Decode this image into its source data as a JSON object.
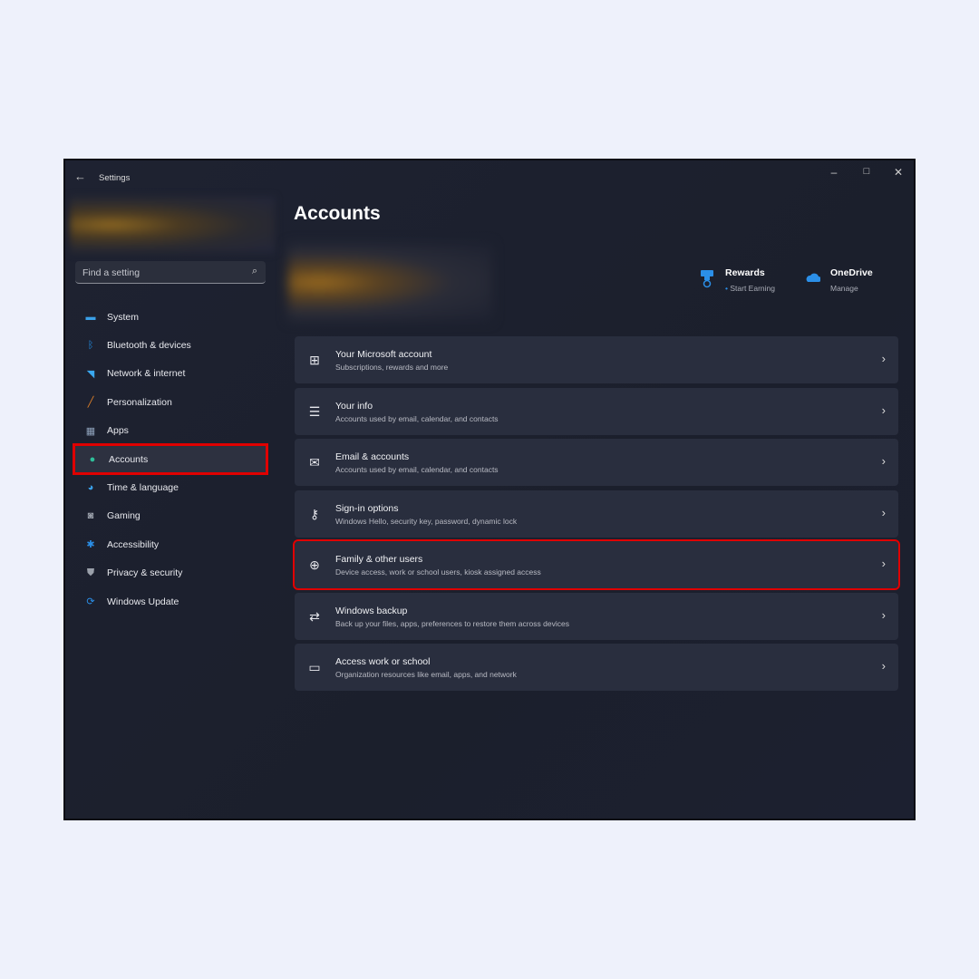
{
  "window": {
    "title": "Settings",
    "minimize": "–",
    "maximize": "□",
    "close": "✕",
    "back": "←"
  },
  "search": {
    "placeholder": "Find a setting"
  },
  "sidebar": {
    "items": [
      {
        "label": "System",
        "icon": "monitor-icon",
        "color": "#3aa0e8"
      },
      {
        "label": "Bluetooth & devices",
        "icon": "bluetooth-icon",
        "color": "#1f8fe6"
      },
      {
        "label": "Network & internet",
        "icon": "wifi-icon",
        "color": "#3aa8f0"
      },
      {
        "label": "Personalization",
        "icon": "brush-icon",
        "color": "#e0802a"
      },
      {
        "label": "Apps",
        "icon": "apps-icon",
        "color": "#8fa2bb"
      },
      {
        "label": "Accounts",
        "icon": "person-icon",
        "color": "#2fbf9a",
        "selected": true
      },
      {
        "label": "Time & language",
        "icon": "globe-clock-icon",
        "color": "#3aa0e8"
      },
      {
        "label": "Gaming",
        "icon": "gamepad-icon",
        "color": "#9aa0aa"
      },
      {
        "label": "Accessibility",
        "icon": "accessibility-icon",
        "color": "#2b8fe8"
      },
      {
        "label": "Privacy & security",
        "icon": "shield-icon",
        "color": "#9aa0aa"
      },
      {
        "label": "Windows Update",
        "icon": "update-icon",
        "color": "#2b8fe8"
      }
    ]
  },
  "main": {
    "title": "Accounts",
    "rewards": {
      "title": "Rewards",
      "subtitle": "Start Earning"
    },
    "onedrive": {
      "title": "OneDrive",
      "subtitle": "Manage"
    },
    "cards": [
      {
        "title": "Your Microsoft account",
        "subtitle": "Subscriptions, rewards and more",
        "icon": "windows-logo-icon"
      },
      {
        "title": "Your info",
        "subtitle": "Accounts used by email, calendar, and contacts",
        "icon": "person-list-icon"
      },
      {
        "title": "Email & accounts",
        "subtitle": "Accounts used by email, calendar, and contacts",
        "icon": "mail-icon"
      },
      {
        "title": "Sign-in options",
        "subtitle": "Windows Hello, security key, password, dynamic lock",
        "icon": "key-icon"
      },
      {
        "title": "Family & other users",
        "subtitle": "Device access, work or school users, kiosk assigned access",
        "icon": "person-add-icon",
        "highlighted": true
      },
      {
        "title": "Windows backup",
        "subtitle": "Back up your files, apps, preferences to restore them across devices",
        "icon": "backup-icon"
      },
      {
        "title": "Access work or school",
        "subtitle": "Organization resources like email, apps, and network",
        "icon": "briefcase-icon"
      }
    ]
  },
  "highlight_color": "#e00000"
}
